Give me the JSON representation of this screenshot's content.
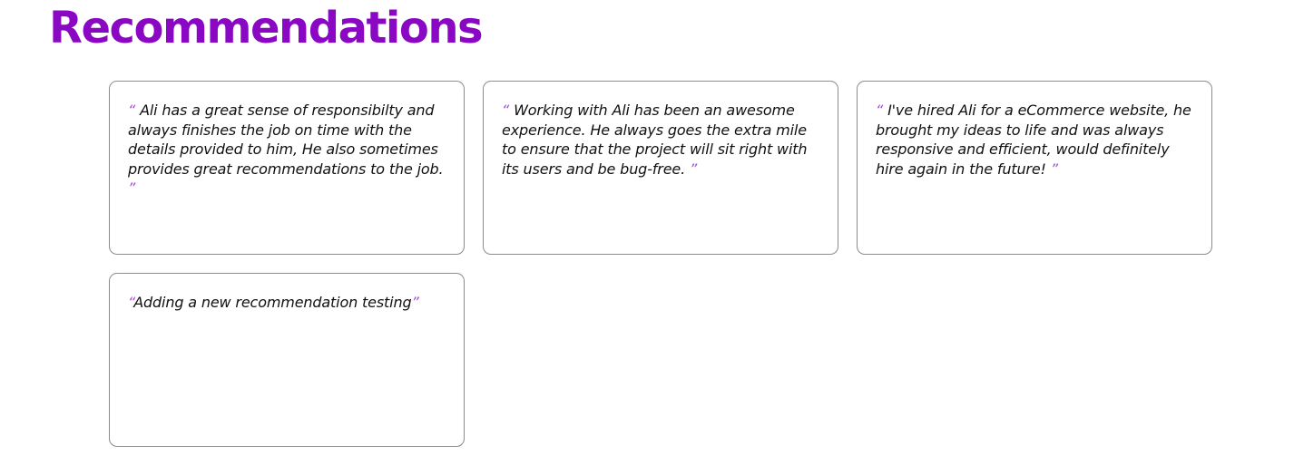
{
  "header": {
    "title": "Recommendations"
  },
  "recommendations": [
    {
      "open": "“",
      "text": "Ali has a great sense of responsibilty and always finishes the job on time with the details provided to him, He also sometimes provides great recommendations to the job.",
      "close": "”"
    },
    {
      "open": "“",
      "text": "Working with Ali has been an awesome experience. He always goes the extra mile to ensure that the project will sit right with its users and be bug-free.",
      "close": "”"
    },
    {
      "open": "“",
      "text": "I've hired Ali for a eCommerce website, he brought my ideas to life and was always responsive and efficient, would definitely hire again in the future!",
      "close": "”"
    },
    {
      "open": "“",
      "text": "Adding a new recommendation testing",
      "close": "”"
    }
  ],
  "colors": {
    "title": "#8a08c4",
    "quote_mark": "#a24fd0",
    "card_border": "#8c8c8c"
  }
}
